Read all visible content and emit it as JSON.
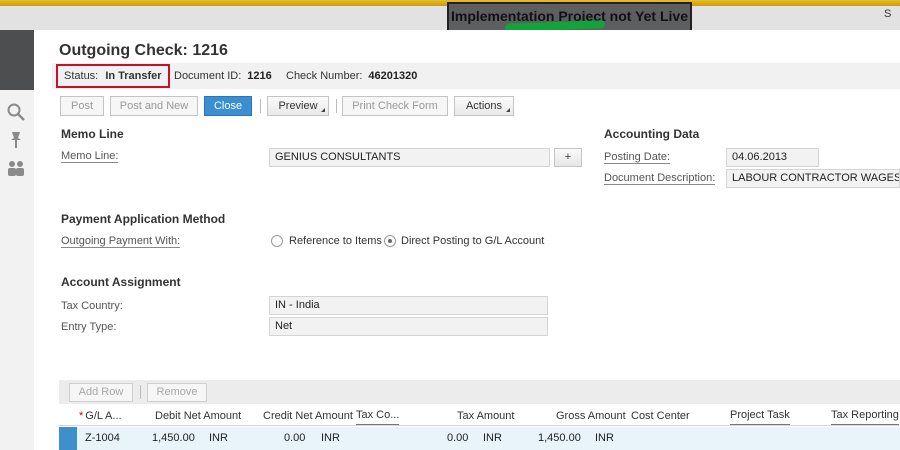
{
  "header": {
    "project_banner": "Implementation Project not Yet Live",
    "corner_text": "S"
  },
  "dialog": {
    "title": "Outgoing Check: 1216",
    "status_label": "Status:",
    "status_value": "In Transfer",
    "document_id_label": "Document ID:",
    "document_id_value": "1216",
    "check_number_label": "Check Number:",
    "check_number_value": "46201320"
  },
  "toolbar": {
    "post": "Post",
    "post_and_new": "Post and New",
    "close": "Close",
    "preview": "Preview",
    "print_check_form": "Print Check Form",
    "actions": "Actions"
  },
  "memo": {
    "section_title": "Memo Line",
    "memo_label": "Memo Line:",
    "memo_value": "GENIUS CONSULTANTS",
    "plus_label": "+"
  },
  "accounting": {
    "section_title": "Accounting Data",
    "posting_date_label": "Posting Date:",
    "posting_date_value": "04.06.2013",
    "doc_desc_label": "Document Description:",
    "doc_desc_value": "LABOUR CONTRACTOR WAGES"
  },
  "payment": {
    "section_title": "Payment Application Method",
    "outgoing_label": "Outgoing Payment With:",
    "option_reference": "Reference to Items",
    "option_direct": "Direct Posting to G/L Account",
    "selected": "Direct Posting to G/L Account"
  },
  "account": {
    "section_title": "Account Assignment",
    "tax_country_label": "Tax Country:",
    "tax_country_value": "IN - India",
    "entry_type_label": "Entry Type:",
    "entry_type_value": "Net"
  },
  "table": {
    "add_row": "Add Row",
    "remove": "Remove",
    "required_mark": "*",
    "columns": {
      "gl_account": "G/L A...",
      "debit_net": "Debit Net Amount",
      "credit_net": "Credit Net Amount",
      "tax_code": "Tax Co...",
      "tax_amount": "Tax Amount",
      "gross_amount": "Gross Amount",
      "cost_center": "Cost Center",
      "project_task": "Project Task",
      "tax_reporting": "Tax Reporting"
    },
    "rows": [
      {
        "gl_account": "Z-1004",
        "debit_net": "1,450.00",
        "debit_currency": "INR",
        "credit_net": "0.00",
        "credit_currency": "INR",
        "tax_amount": "0.00",
        "tax_currency": "INR",
        "gross_amount": "1,450.00",
        "gross_currency": "INR"
      }
    ]
  }
}
